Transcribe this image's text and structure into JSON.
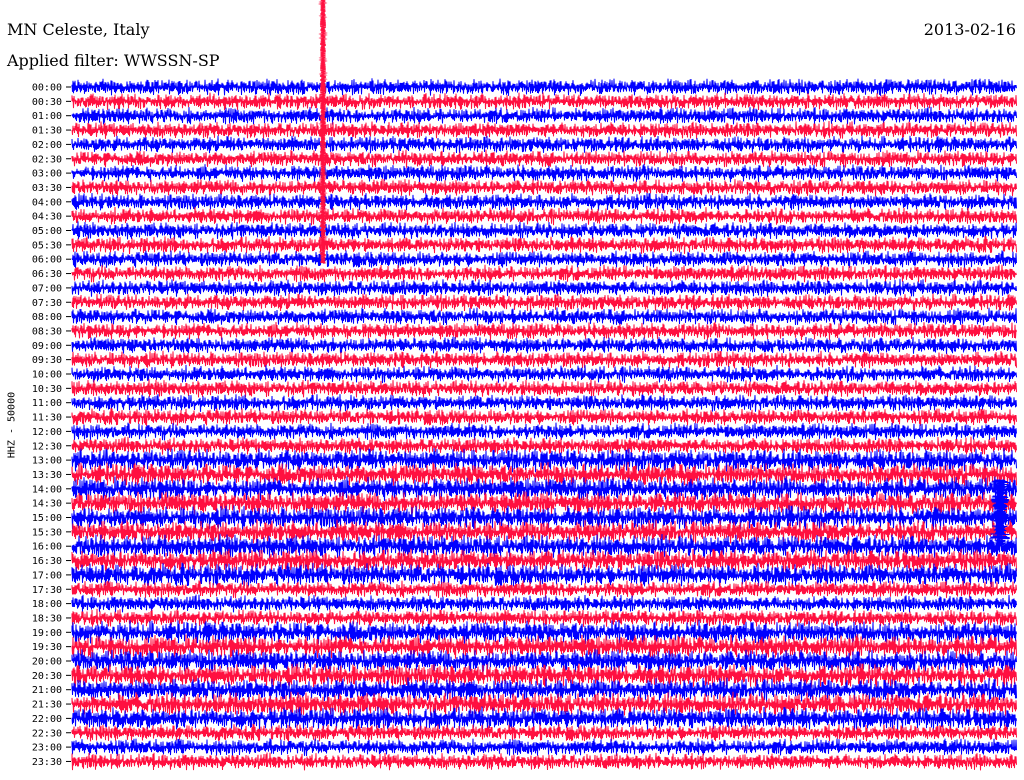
{
  "header": {
    "station": "MN Celeste, Italy",
    "date": "2013-02-16",
    "filter": "Applied filter: WWSSN-SP"
  },
  "chart_data": {
    "type": "line",
    "ylabel": "HHZ - 50000",
    "row_labels": [
      "00:00",
      "00:30",
      "01:00",
      "01:30",
      "02:00",
      "02:30",
      "03:00",
      "03:30",
      "04:00",
      "04:30",
      "05:00",
      "05:30",
      "06:00",
      "06:30",
      "07:00",
      "07:30",
      "08:00",
      "08:30",
      "09:00",
      "09:30",
      "10:00",
      "10:30",
      "11:00",
      "11:30",
      "12:00",
      "12:30",
      "13:00",
      "13:30",
      "14:00",
      "14:30",
      "15:00",
      "15:30",
      "16:00",
      "16:30",
      "17:00",
      "17:30",
      "18:00",
      "18:30",
      "19:00",
      "19:30",
      "20:00",
      "20:30",
      "21:00",
      "21:30",
      "22:00",
      "22:30",
      "23:00",
      "23:30"
    ],
    "trace_colors": [
      "#0000ff",
      "#ff1040"
    ]
  }
}
